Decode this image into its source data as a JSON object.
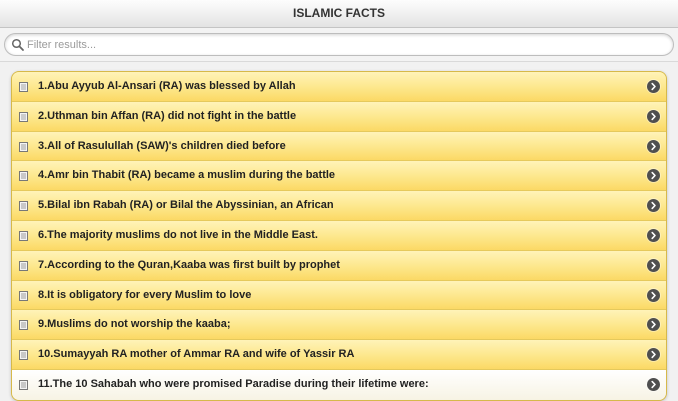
{
  "header": {
    "title": "ISLAMIC FACTS"
  },
  "search": {
    "placeholder": "Filter results..."
  },
  "list": {
    "items": [
      {
        "label": "1.Abu Ayyub Al-Ansari (RA) was blessed by Allah"
      },
      {
        "label": "2.Uthman bin Affan (RA) did not fight in the battle"
      },
      {
        "label": "3.All of Rasulullah (SAW)'s children died before"
      },
      {
        "label": "4.Amr bin Thabit (RA) became a muslim during the battle"
      },
      {
        "label": "5.Bilal ibn Rabah (RA) or Bilal the Abyssinian, an African"
      },
      {
        "label": "6.The majority muslims do not live in the Middle East."
      },
      {
        "label": "7.According to the Quran,Kaaba was first built by prophet"
      },
      {
        "label": "8.It is obligatory for every Muslim to love"
      },
      {
        "label": "9.Muslims do not worship the kaaba;"
      },
      {
        "label": "10.Sumayyah RA mother of Ammar RA and wife of Yassir RA"
      },
      {
        "label": "11.The 10 Sahabah who were promised Paradise during their lifetime were:"
      }
    ],
    "item_icon": "document-icon",
    "arrow_icon": "chevron-right-icon"
  },
  "colors": {
    "item_top": "#fff3b8",
    "item_bottom": "#fbd965",
    "arrow": "#4f4f4f"
  }
}
